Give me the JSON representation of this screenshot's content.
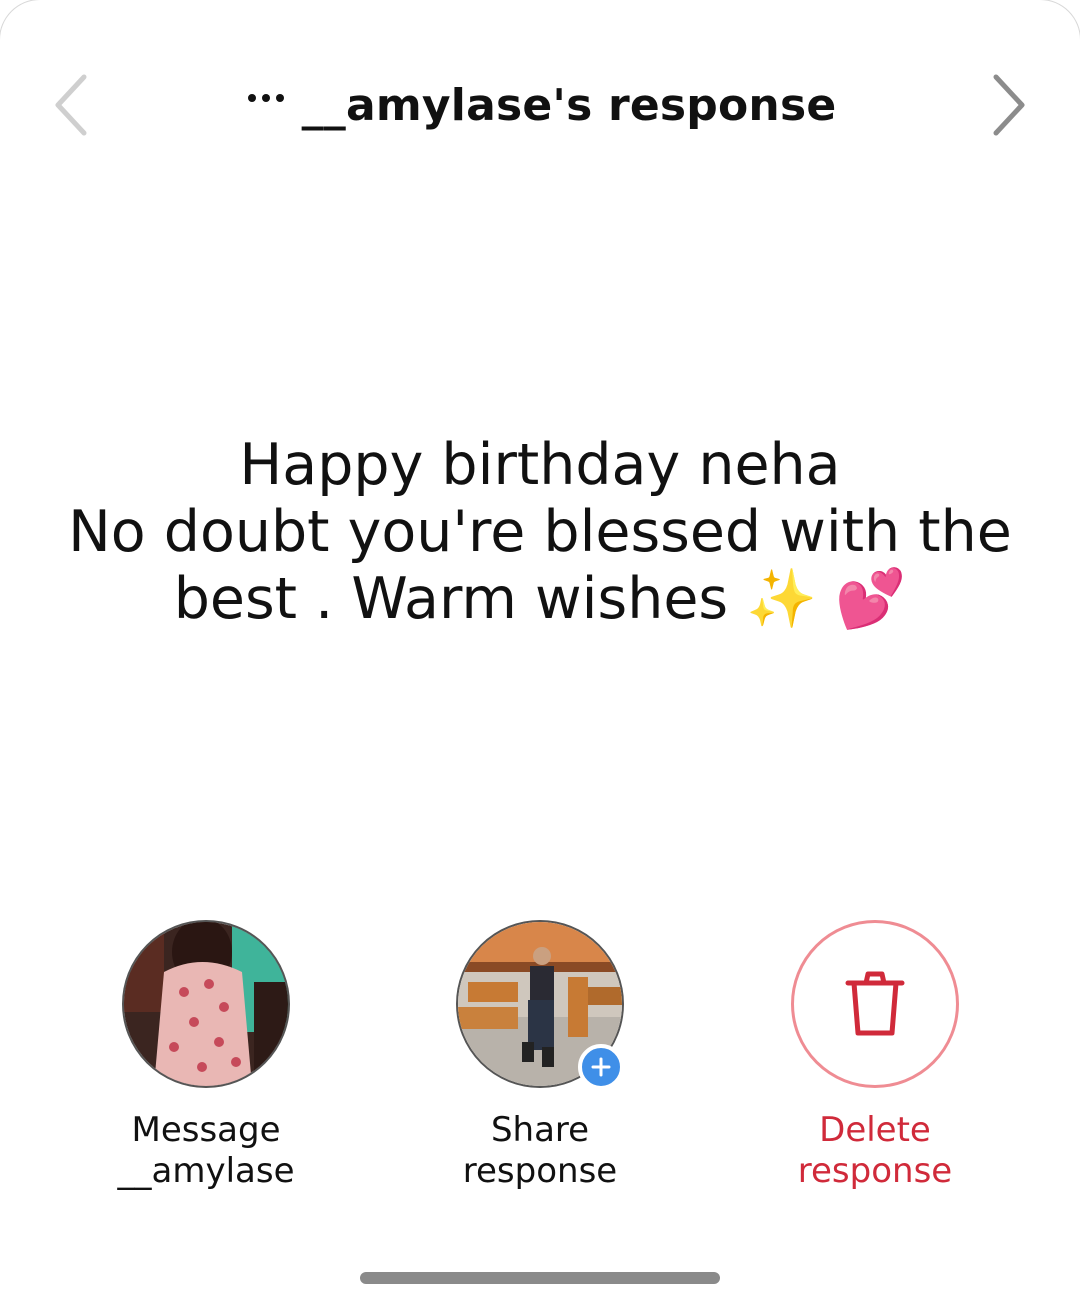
{
  "header": {
    "title": "__amylase's response",
    "prev_icon": "chevron-left-icon",
    "next_icon": "chevron-right-icon",
    "more_icon": "more-dots-icon"
  },
  "response": {
    "lines": [
      "Happy birthday neha",
      "No doubt you're blessed with the",
      "best . Warm wishes ✨ 💕"
    ]
  },
  "actions": {
    "message": {
      "line1": "Message",
      "line2": "__amylase"
    },
    "share": {
      "line1": "Share",
      "line2": "response"
    },
    "delete": {
      "line1": "Delete",
      "line2": "response"
    }
  },
  "colors": {
    "danger": "#d02a3a",
    "delete_ring": "#ef8c93",
    "badge": "#3f8fe8",
    "chevron_left": "#cfcfcf",
    "chevron_right": "#8c8c8c"
  }
}
